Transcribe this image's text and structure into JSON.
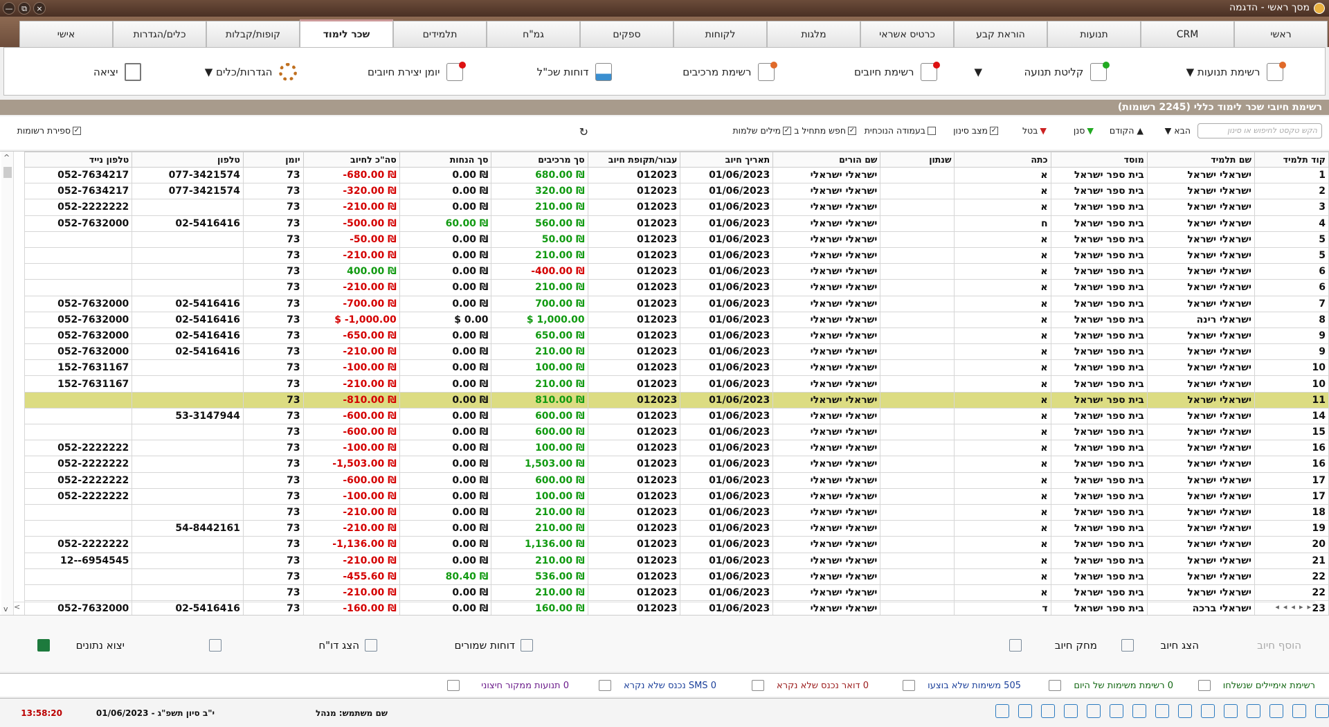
{
  "window": {
    "title": "מסך ראשי - הדגמה",
    "controls": [
      "×",
      "⧉",
      "—"
    ]
  },
  "tabs": [
    "ראשי",
    "CRM",
    "תנועות",
    "הוראת קבע",
    "כרטיס אשראי",
    "מלגות",
    "לקוחות",
    "ספקים",
    "גמ\"ח",
    "תלמידים",
    "שכר לימוד",
    "קופות/קבלות",
    "כלים/הגדרות",
    "אישי"
  ],
  "active_tab": "שכר לימוד",
  "toolbar": [
    {
      "label": "רשימת תנועות ▼",
      "icon": "list-doc-icon"
    },
    {
      "label": "קליטת תנועה",
      "icon": "add-doc-icon"
    },
    {
      "label": "▼",
      "icon": "dropdown-arrow-icon"
    },
    {
      "label": "רשימת חיובים",
      "icon": "charges-doc-icon"
    },
    {
      "label": "רשימת מרכיבים",
      "icon": "components-icon"
    },
    {
      "label": "דוחות שכ\"ל",
      "icon": "report-chart-icon"
    },
    {
      "label": "יומן יצירת חיובים",
      "icon": "journal-icon"
    },
    {
      "label": "הגדרות/כלים ▼",
      "icon": "gear-icon"
    },
    {
      "label": "יציאה",
      "icon": "exit-icon"
    }
  ],
  "section_title": "רשימת חיובי שכר לימוד כללי (2245 רשומות)",
  "filters": {
    "search_placeholder": "הקש טקסט לחיפוש או סינון",
    "next": "הבא ▼",
    "prev": "▲ הקודם",
    "sort": "סנן",
    "cancel": "בטל",
    "filter_state": "מצב סינון",
    "current_column": "בעמודה הנוכחית",
    "starts_with": "חפש מתחיל ב",
    "whole_words": "מילים שלמות",
    "record_count": "ספירת רשומות"
  },
  "columns": [
    "קוד תלמיד",
    "שם תלמיד",
    "מוסד",
    "כתה",
    "שנתון",
    "שם הורים",
    "תאריך חיוב",
    "עבור/תקופת חיוב",
    "סך מרכיבים",
    "סך הנחות",
    "סה\"כ לחיוב",
    "יומן",
    "טלפון",
    "טלפון נייד"
  ],
  "rows": [
    {
      "id": "1",
      "name": "ישראלי ישראל",
      "inst": "בית ספר ישראל",
      "cls": "א",
      "yr": "",
      "parent": "ישראלי ישראלי",
      "date": "01/06/2023",
      "period": "012023",
      "comp": "680.00 ₪",
      "comp_c": "g",
      "disc": "0.00 ₪",
      "disc_c": "",
      "total": "-680.00 ₪",
      "total_c": "r",
      "log": "73",
      "phone": "077-3421574",
      "mobile": "052-7634217"
    },
    {
      "id": "2",
      "name": "ישראלי ישראל",
      "inst": "בית ספר ישראל",
      "cls": "א",
      "yr": "",
      "parent": "ישראלי ישראלי",
      "date": "01/06/2023",
      "period": "012023",
      "comp": "320.00 ₪",
      "comp_c": "g",
      "disc": "0.00 ₪",
      "disc_c": "",
      "total": "-320.00 ₪",
      "total_c": "r",
      "log": "73",
      "phone": "077-3421574",
      "mobile": "052-7634217"
    },
    {
      "id": "3",
      "name": "ישראלי ישראל",
      "inst": "בית ספר ישראל",
      "cls": "א",
      "yr": "",
      "parent": "ישראלי ישראלי",
      "date": "01/06/2023",
      "period": "012023",
      "comp": "210.00 ₪",
      "comp_c": "g",
      "disc": "0.00 ₪",
      "disc_c": "",
      "total": "-210.00 ₪",
      "total_c": "r",
      "log": "73",
      "phone": "",
      "mobile": "052-2222222"
    },
    {
      "id": "4",
      "name": "ישראלי ישראל",
      "inst": "בית ספר ישראל",
      "cls": "ח",
      "yr": "",
      "parent": "ישראלי ישראלי",
      "date": "01/06/2023",
      "period": "012023",
      "comp": "560.00 ₪",
      "comp_c": "g",
      "disc": "60.00 ₪",
      "disc_c": "g",
      "total": "-500.00 ₪",
      "total_c": "r",
      "log": "73",
      "phone": "02-5416416",
      "mobile": "052-7632000"
    },
    {
      "id": "5",
      "name": "ישראלי ישראל",
      "inst": "בית ספר ישראל",
      "cls": "א",
      "yr": "",
      "parent": "ישראלי ישראלי",
      "date": "01/06/2023",
      "period": "012023",
      "comp": "50.00 ₪",
      "comp_c": "g",
      "disc": "0.00 ₪",
      "disc_c": "",
      "total": "-50.00 ₪",
      "total_c": "r",
      "log": "73",
      "phone": "",
      "mobile": ""
    },
    {
      "id": "5",
      "name": "ישראלי ישראל",
      "inst": "בית ספר ישראל",
      "cls": "א",
      "yr": "",
      "parent": "ישראלי ישראלי",
      "date": "01/06/2023",
      "period": "012023",
      "comp": "210.00 ₪",
      "comp_c": "g",
      "disc": "0.00 ₪",
      "disc_c": "",
      "total": "-210.00 ₪",
      "total_c": "r",
      "log": "73",
      "phone": "",
      "mobile": ""
    },
    {
      "id": "6",
      "name": "ישראלי ישראל",
      "inst": "בית ספר ישראל",
      "cls": "א",
      "yr": "",
      "parent": "ישראלי ישראלי",
      "date": "01/06/2023",
      "period": "012023",
      "comp": "-400.00 ₪",
      "comp_c": "r",
      "disc": "0.00 ₪",
      "disc_c": "",
      "total": "400.00 ₪",
      "total_c": "g",
      "log": "73",
      "phone": "",
      "mobile": ""
    },
    {
      "id": "6",
      "name": "ישראלי ישראל",
      "inst": "בית ספר ישראל",
      "cls": "א",
      "yr": "",
      "parent": "ישראלי ישראלי",
      "date": "01/06/2023",
      "period": "012023",
      "comp": "210.00 ₪",
      "comp_c": "g",
      "disc": "0.00 ₪",
      "disc_c": "",
      "total": "-210.00 ₪",
      "total_c": "r",
      "log": "73",
      "phone": "",
      "mobile": ""
    },
    {
      "id": "7",
      "name": "ישראלי ישראל",
      "inst": "בית ספר ישראל",
      "cls": "א",
      "yr": "",
      "parent": "ישראלי ישראלי",
      "date": "01/06/2023",
      "period": "012023",
      "comp": "700.00 ₪",
      "comp_c": "g",
      "disc": "0.00 ₪",
      "disc_c": "",
      "total": "-700.00 ₪",
      "total_c": "r",
      "log": "73",
      "phone": "02-5416416",
      "mobile": "052-7632000"
    },
    {
      "id": "8",
      "name": "ישראלי רינה",
      "inst": "בית ספר ישראל",
      "cls": "א",
      "yr": "",
      "parent": "ישראלי ישראלי",
      "date": "01/06/2023",
      "period": "012023",
      "comp": "$ 1,000.00",
      "comp_c": "g",
      "disc": "$ 0.00",
      "disc_c": "",
      "total": "$ -1,000.00",
      "total_c": "r",
      "log": "73",
      "phone": "02-5416416",
      "mobile": "052-7632000"
    },
    {
      "id": "9",
      "name": "ישראלי ישראל",
      "inst": "בית ספר ישראל",
      "cls": "א",
      "yr": "",
      "parent": "ישראלי ישראלי",
      "date": "01/06/2023",
      "period": "012023",
      "comp": "650.00 ₪",
      "comp_c": "g",
      "disc": "0.00 ₪",
      "disc_c": "",
      "total": "-650.00 ₪",
      "total_c": "r",
      "log": "73",
      "phone": "02-5416416",
      "mobile": "052-7632000"
    },
    {
      "id": "9",
      "name": "ישראלי ישראל",
      "inst": "בית ספר ישראל",
      "cls": "א",
      "yr": "",
      "parent": "ישראלי ישראלי",
      "date": "01/06/2023",
      "period": "012023",
      "comp": "210.00 ₪",
      "comp_c": "g",
      "disc": "0.00 ₪",
      "disc_c": "",
      "total": "-210.00 ₪",
      "total_c": "r",
      "log": "73",
      "phone": "02-5416416",
      "mobile": "052-7632000"
    },
    {
      "id": "10",
      "name": "ישראלי ישראל",
      "inst": "בית ספר ישראל",
      "cls": "א",
      "yr": "",
      "parent": "ישראלי ישראלי",
      "date": "01/06/2023",
      "period": "012023",
      "comp": "100.00 ₪",
      "comp_c": "g",
      "disc": "0.00 ₪",
      "disc_c": "",
      "total": "-100.00 ₪",
      "total_c": "r",
      "log": "73",
      "phone": "",
      "mobile": "152-7631167"
    },
    {
      "id": "10",
      "name": "ישראלי ישראל",
      "inst": "בית ספר ישראל",
      "cls": "א",
      "yr": "",
      "parent": "ישראלי ישראלי",
      "date": "01/06/2023",
      "period": "012023",
      "comp": "210.00 ₪",
      "comp_c": "g",
      "disc": "0.00 ₪",
      "disc_c": "",
      "total": "-210.00 ₪",
      "total_c": "r",
      "log": "73",
      "phone": "",
      "mobile": "152-7631167"
    },
    {
      "id": "11",
      "name": "ישראלי ישראל",
      "inst": "בית ספר ישראל",
      "cls": "א",
      "yr": "",
      "parent": "ישראלי ישראלי",
      "date": "01/06/2023",
      "period": "012023",
      "comp": "810.00 ₪",
      "comp_c": "g",
      "disc": "0.00 ₪",
      "disc_c": "",
      "total": "-810.00 ₪",
      "total_c": "r",
      "log": "73",
      "phone": "",
      "mobile": "",
      "selected": true
    },
    {
      "id": "14",
      "name": "ישראלי ישראל",
      "inst": "בית ספר ישראל",
      "cls": "א",
      "yr": "",
      "parent": "ישראלי ישראלי",
      "date": "01/06/2023",
      "period": "012023",
      "comp": "600.00 ₪",
      "comp_c": "g",
      "disc": "0.00 ₪",
      "disc_c": "",
      "total": "-600.00 ₪",
      "total_c": "r",
      "log": "73",
      "phone": "53-3147944",
      "mobile": ""
    },
    {
      "id": "15",
      "name": "ישראלי ישראל",
      "inst": "בית ספר ישראל",
      "cls": "א",
      "yr": "",
      "parent": "ישראלי ישראלי",
      "date": "01/06/2023",
      "period": "012023",
      "comp": "600.00 ₪",
      "comp_c": "g",
      "disc": "0.00 ₪",
      "disc_c": "",
      "total": "-600.00 ₪",
      "total_c": "r",
      "log": "73",
      "phone": "",
      "mobile": ""
    },
    {
      "id": "16",
      "name": "ישראלי ישראל",
      "inst": "בית ספר ישראל",
      "cls": "א",
      "yr": "",
      "parent": "ישראלי ישראלי",
      "date": "01/06/2023",
      "period": "012023",
      "comp": "100.00 ₪",
      "comp_c": "g",
      "disc": "0.00 ₪",
      "disc_c": "",
      "total": "-100.00 ₪",
      "total_c": "r",
      "log": "73",
      "phone": "",
      "mobile": "052-2222222"
    },
    {
      "id": "16",
      "name": "ישראלי ישראל",
      "inst": "בית ספר ישראל",
      "cls": "א",
      "yr": "",
      "parent": "ישראלי ישראלי",
      "date": "01/06/2023",
      "period": "012023",
      "comp": "1,503.00 ₪",
      "comp_c": "g",
      "disc": "0.00 ₪",
      "disc_c": "",
      "total": "-1,503.00 ₪",
      "total_c": "r",
      "log": "73",
      "phone": "",
      "mobile": "052-2222222"
    },
    {
      "id": "17",
      "name": "ישראלי ישראל",
      "inst": "בית ספר ישראל",
      "cls": "א",
      "yr": "",
      "parent": "ישראלי ישראלי",
      "date": "01/06/2023",
      "period": "012023",
      "comp": "600.00 ₪",
      "comp_c": "g",
      "disc": "0.00 ₪",
      "disc_c": "",
      "total": "-600.00 ₪",
      "total_c": "r",
      "log": "73",
      "phone": "",
      "mobile": "052-2222222"
    },
    {
      "id": "17",
      "name": "ישראלי ישראל",
      "inst": "בית ספר ישראל",
      "cls": "א",
      "yr": "",
      "parent": "ישראלי ישראלי",
      "date": "01/06/2023",
      "period": "012023",
      "comp": "100.00 ₪",
      "comp_c": "g",
      "disc": "0.00 ₪",
      "disc_c": "",
      "total": "-100.00 ₪",
      "total_c": "r",
      "log": "73",
      "phone": "",
      "mobile": "052-2222222"
    },
    {
      "id": "18",
      "name": "ישראלי ישראל",
      "inst": "בית ספר ישראל",
      "cls": "א",
      "yr": "",
      "parent": "ישראלי ישראלי",
      "date": "01/06/2023",
      "period": "012023",
      "comp": "210.00 ₪",
      "comp_c": "g",
      "disc": "0.00 ₪",
      "disc_c": "",
      "total": "-210.00 ₪",
      "total_c": "r",
      "log": "73",
      "phone": "",
      "mobile": ""
    },
    {
      "id": "19",
      "name": "ישראלי ישראל",
      "inst": "בית ספר ישראל",
      "cls": "א",
      "yr": "",
      "parent": "ישראלי ישראלי",
      "date": "01/06/2023",
      "period": "012023",
      "comp": "210.00 ₪",
      "comp_c": "g",
      "disc": "0.00 ₪",
      "disc_c": "",
      "total": "-210.00 ₪",
      "total_c": "r",
      "log": "73",
      "phone": "54-8442161",
      "mobile": ""
    },
    {
      "id": "20",
      "name": "ישראלי ישראל",
      "inst": "בית ספר ישראל",
      "cls": "א",
      "yr": "",
      "parent": "ישראלי ישראלי",
      "date": "01/06/2023",
      "period": "012023",
      "comp": "1,136.00 ₪",
      "comp_c": "g",
      "disc": "0.00 ₪",
      "disc_c": "",
      "total": "-1,136.00 ₪",
      "total_c": "r",
      "log": "73",
      "phone": "",
      "mobile": "052-2222222"
    },
    {
      "id": "21",
      "name": "ישראלי ישראל",
      "inst": "בית ספר ישראל",
      "cls": "א",
      "yr": "",
      "parent": "ישראלי ישראלי",
      "date": "01/06/2023",
      "period": "012023",
      "comp": "210.00 ₪",
      "comp_c": "g",
      "disc": "0.00 ₪",
      "disc_c": "",
      "total": "-210.00 ₪",
      "total_c": "r",
      "log": "73",
      "phone": "",
      "mobile": "12--6954545"
    },
    {
      "id": "22",
      "name": "ישראלי ישראל",
      "inst": "בית ספר ישראל",
      "cls": "א",
      "yr": "",
      "parent": "ישראלי ישראלי",
      "date": "01/06/2023",
      "period": "012023",
      "comp": "536.00 ₪",
      "comp_c": "g",
      "disc": "80.40 ₪",
      "disc_c": "g",
      "total": "-455.60 ₪",
      "total_c": "r",
      "log": "73",
      "phone": "",
      "mobile": ""
    },
    {
      "id": "22",
      "name": "ישראלי ישראל",
      "inst": "בית ספר ישראל",
      "cls": "א",
      "yr": "",
      "parent": "ישראלי ישראלי",
      "date": "01/06/2023",
      "period": "012023",
      "comp": "210.00 ₪",
      "comp_c": "g",
      "disc": "0.00 ₪",
      "disc_c": "",
      "total": "-210.00 ₪",
      "total_c": "r",
      "log": "73",
      "phone": "",
      "mobile": ""
    },
    {
      "id": "23",
      "name": "ישראלי ברכה",
      "inst": "בית ספר ישראל",
      "cls": "ד",
      "yr": "",
      "parent": "ישראלי ישראלי",
      "date": "01/06/2023",
      "period": "012023",
      "comp": "160.00 ₪",
      "comp_c": "g",
      "disc": "0.00 ₪",
      "disc_c": "",
      "total": "-160.00 ₪",
      "total_c": "r",
      "log": "73",
      "phone": "02-5416416",
      "mobile": "052-7632000"
    }
  ],
  "actions": {
    "add": "הוסף חיוב",
    "show": "הצג חיוב",
    "delete": "מחק חיוב",
    "saved_reports": "דוחות שמורים",
    "show_report": "הצג דו\"ח",
    "export": "יצוא נתונים"
  },
  "status_bar": {
    "emails": "רשימת אימיילים שנשלחו",
    "today_tasks": "0 רשימת משימות של היום",
    "undone_tasks": "505 משימות שלא בוצעו",
    "unread_mail": "0 דואר נכנס שלא נקרא",
    "unread_sms": "0 SMS נכנס שלא נקרא",
    "ext_moves": "0 תנועות ממקור חיצוני"
  },
  "footer": {
    "user": "שם משתמש: מנהל",
    "hebrew_date": "י\"ב סיון תשפ\"ג - 01/06/2023",
    "time": "13:58:20"
  }
}
